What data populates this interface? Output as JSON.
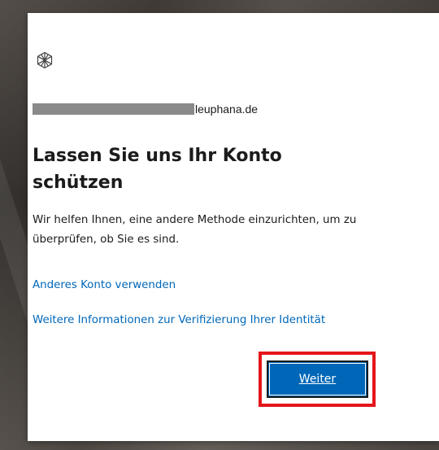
{
  "identity": {
    "domain": "leuphana.de"
  },
  "page": {
    "title": "Lassen Sie uns Ihr Konto schützen",
    "description": "Wir helfen Ihnen, eine andere Methode einzurichten, um zu überprüfen, ob Sie es sind."
  },
  "links": {
    "other_account": "Anderes Konto verwenden",
    "more_info": "Weitere Informationen zur Verifizierung Ihrer Identität"
  },
  "actions": {
    "next_label": "Weiter"
  },
  "colors": {
    "link": "#0067b8",
    "primary_button": "#0067b8",
    "highlight_border": "#e4161b"
  },
  "icons": {
    "logo": "organization-logo-icon"
  }
}
